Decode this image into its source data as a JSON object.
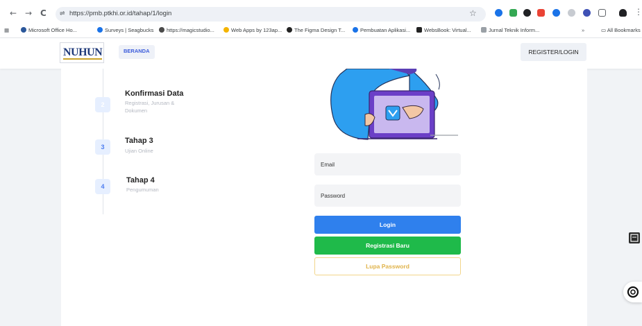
{
  "browser": {
    "back": "←",
    "forward": "→",
    "reload": "C",
    "url": "https://pmb.ptkhi.or.id/tahap/1/login",
    "star": "☆",
    "bookmarks": [
      {
        "label": "Microsoft Office Ho...",
        "color": "#2b579a"
      },
      {
        "label": "Surveys | Seagbucks",
        "color": "#1a73e8"
      },
      {
        "label": "https://magicstudio...",
        "color": "#4a4a4a"
      },
      {
        "label": "Web Apps by 123ap...",
        "color": "#f4b400"
      },
      {
        "label": "The Figma Design T...",
        "color": "#222222"
      },
      {
        "label": "Pembuatan Aplikasi...",
        "color": "#1a73e8"
      },
      {
        "label": "WebsBook: Virtual...",
        "color": "#222222"
      },
      {
        "label": "Jurnal Teknik Inform...",
        "color": "#9aa0a6"
      }
    ],
    "all_bookmarks": "All Bookmarks"
  },
  "header": {
    "logo_text": "NUHUN",
    "nav_beranda": "BERANDA",
    "register_login": "REGISTER/LOGIN"
  },
  "steps": [
    {
      "num": "2",
      "title": "Konfirmasi Data",
      "desc": "Registrasi, Jurusan & Dokumen"
    },
    {
      "num": "3",
      "title": "Tahap 3",
      "desc": "Ujian Online"
    },
    {
      "num": "4",
      "title": "Tahap 4",
      "desc": "Pengumuman"
    }
  ],
  "form": {
    "email_placeholder": "Email",
    "password_placeholder": "Password",
    "login": "Login",
    "registrasi": "Registrasi Baru",
    "lupa": "Lupa Password"
  },
  "colors": {
    "primary": "#2f80ed",
    "success": "#1fba4a",
    "warning": "#e0b34a"
  }
}
